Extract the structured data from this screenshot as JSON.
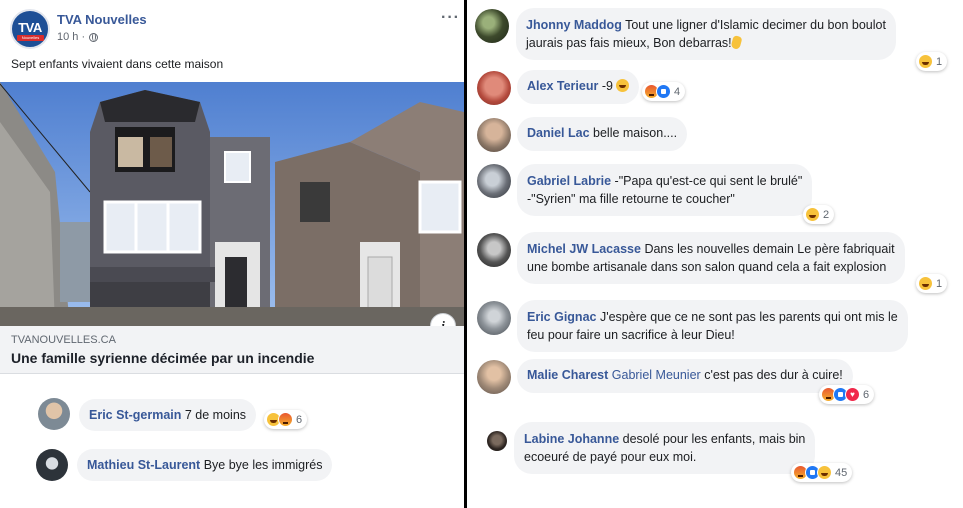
{
  "post": {
    "page_name": "TVA Nouvelles",
    "logo_text": "TVA",
    "logo_subtext": "Nouvelles",
    "time": "10 h ·",
    "text": "Sept enfants vivaient dans cette maison",
    "link_domain": "TVANOUVELLES.CA",
    "link_title": "Une famille syrienne décimée par un incendie",
    "info_label": "i"
  },
  "left_comments": [
    {
      "author": "Eric St-germain",
      "text": "7 de moins",
      "reactions": [
        "haha",
        "angry"
      ],
      "count": "6"
    },
    {
      "author": "Mathieu St-Laurent",
      "text": "Bye bye les immigrés"
    }
  ],
  "right_comments": [
    {
      "author": "Jhonny Maddog",
      "line1": "Tout une ligner d'Islamic decimer du bon boulot",
      "line2": "jaurais pas fais mieux, Bon debarras!",
      "reactions": [
        "haha"
      ],
      "count": "1"
    },
    {
      "author": "Alex Terieur",
      "text": "-9",
      "reactions": [
        "angry",
        "like"
      ],
      "count": "4"
    },
    {
      "author": "Daniel Lac",
      "text": "belle maison...."
    },
    {
      "author": "Gabriel Labrie",
      "line1": "-\"Papa qu'est-ce qui sent le brulé\"",
      "line2": "-\"Syrien\" ma fille retourne te coucher\"",
      "reactions": [
        "haha"
      ],
      "count": "2"
    },
    {
      "author": "Michel JW Lacasse",
      "line1": "Dans les nouvelles demain Le père fabriquait",
      "line2": "une bombe artisanale dans son salon quand cela a fait explosion",
      "reactions": [
        "haha"
      ],
      "count": "1"
    },
    {
      "author": "Eric Gignac",
      "line1": "J'espère que ce ne sont pas les parents qui ont mis le",
      "line2": "feu pour faire un sacrifice à leur Dieu!"
    },
    {
      "author": "Malie Charest",
      "mention": "Gabriel Meunier",
      "text": "c'est pas des dur à cuire!",
      "reactions": [
        "angry",
        "like",
        "love"
      ],
      "count": "6"
    },
    {
      "author": "Labine Johanne",
      "line1": "desolé pour les enfants, mais bin",
      "line2": "ecoeuré de payé pour eux moi.",
      "reactions": [
        "angry",
        "like",
        "haha"
      ],
      "count": "45"
    }
  ],
  "colors": {
    "link_blue": "#385898",
    "bubble_grey": "#f2f3f5",
    "tva_blue": "#1d4f96"
  }
}
